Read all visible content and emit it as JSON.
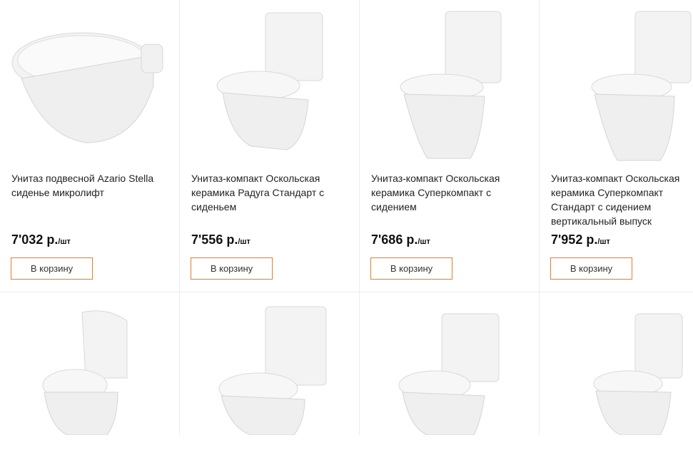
{
  "products": [
    {
      "title": "Унитаз подвесной Azario Stella сиденье микролифт",
      "price": "7'032 р.",
      "unit": "/шт",
      "button": "В корзину",
      "image": "wall-hung-toilet-icon"
    },
    {
      "title": "Унитаз-компакт Оскольская керамика Радуга Стандарт с сиденьем",
      "price": "7'556 р.",
      "unit": "/шт",
      "button": "В корзину",
      "image": "close-coupled-toilet-icon"
    },
    {
      "title": "Унитаз-компакт Оскольская керамика Суперкомпакт с сидением",
      "price": "7'686 р.",
      "unit": "/шт",
      "button": "В корзину",
      "image": "close-coupled-toilet-icon"
    },
    {
      "title": "Унитаз-компакт Оскольская керамика Суперкомпакт Стандарт с сидением вертикальный выпуск",
      "price": "7'952 р.",
      "unit": "/шт",
      "button": "В корзину",
      "image": "close-coupled-toilet-icon"
    }
  ],
  "accent_color": "#e07f2a"
}
